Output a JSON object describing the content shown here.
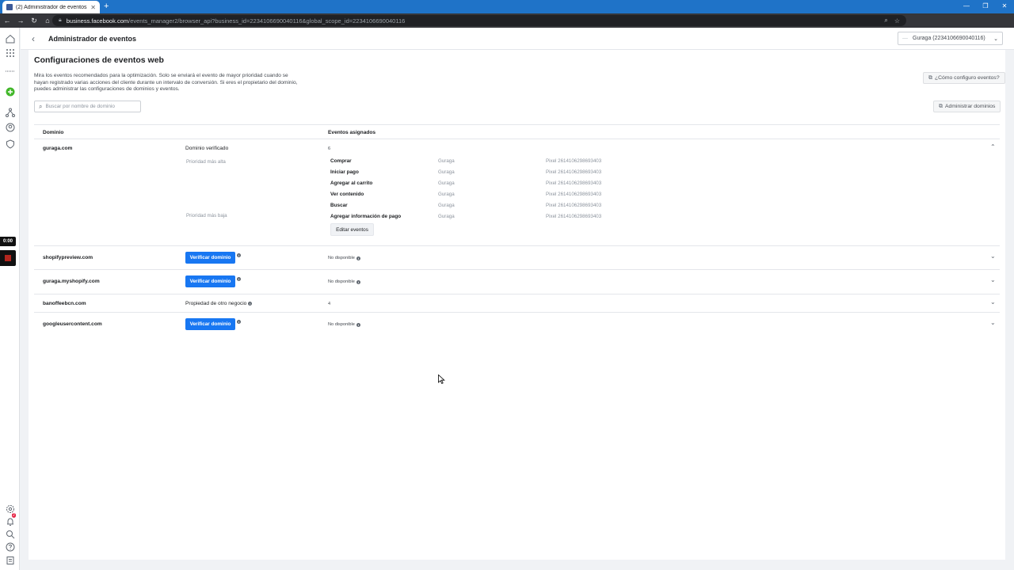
{
  "browser": {
    "tab_title": "(2) Administrador de eventos",
    "url_host": "business.facebook.com",
    "url_path": "/events_manager2/browser_api?business_id=2234106690040116&global_scope_id=2234106690040116"
  },
  "header": {
    "title": "Administrador de eventos",
    "account": "Guraga (2234106690040116)"
  },
  "card": {
    "title": "Configuraciones de eventos web",
    "description": "Mira los eventos recomendados para la optimización. Solo se enviará el evento de mayor prioridad cuando se hayan registrado varias acciones del cliente durante un intervalo de conversión. Si eres el propietario del dominio, puedes administrar las configuraciones de dominios y eventos.",
    "howto_label": "¿Cómo configuro eventos?",
    "search_placeholder": "Buscar por nombre de dominio",
    "admin_domains_label": "Administrar dominios"
  },
  "table": {
    "col_domain": "Dominio",
    "col_events": "Eventos asignados",
    "expanded": {
      "domain": "guraga.com",
      "status": "Dominio verificado",
      "count": "6",
      "priority_high": "Prioridad más alta",
      "priority_low": "Prioridad más baja",
      "events": [
        {
          "name": "Comprar",
          "source": "Guraga",
          "pixel": "Pixel 2614106298693403"
        },
        {
          "name": "Iniciar pago",
          "source": "Guraga",
          "pixel": "Pixel 2614106298693403"
        },
        {
          "name": "Agregar al carrito",
          "source": "Guraga",
          "pixel": "Pixel 2614106298693403"
        },
        {
          "name": "Ver contenido",
          "source": "Guraga",
          "pixel": "Pixel 2614106298693403"
        },
        {
          "name": "Buscar",
          "source": "Guraga",
          "pixel": "Pixel 2614106298693403"
        },
        {
          "name": "Agregar información de pago",
          "source": "Guraga",
          "pixel": "Pixel 2614106298693403"
        }
      ],
      "edit_label": "Editar eventos"
    },
    "rows": [
      {
        "domain": "shopifypreview.com",
        "button": "Verificar dominio",
        "events": "No disponible"
      },
      {
        "domain": "guraga.myshopify.com",
        "button": "Verificar dominio",
        "events": "No disponible"
      },
      {
        "domain": "banoffeebcn.com",
        "status": "Propiedad de otro negocio",
        "events": "4"
      },
      {
        "domain": "googleusercontent.com",
        "button": "Verificar dominio",
        "events": "No disponible"
      }
    ]
  },
  "recorder": {
    "timer": "0:00"
  },
  "colors": {
    "primary": "#1877f2",
    "browser_tab_bar": "#1f73c8"
  }
}
